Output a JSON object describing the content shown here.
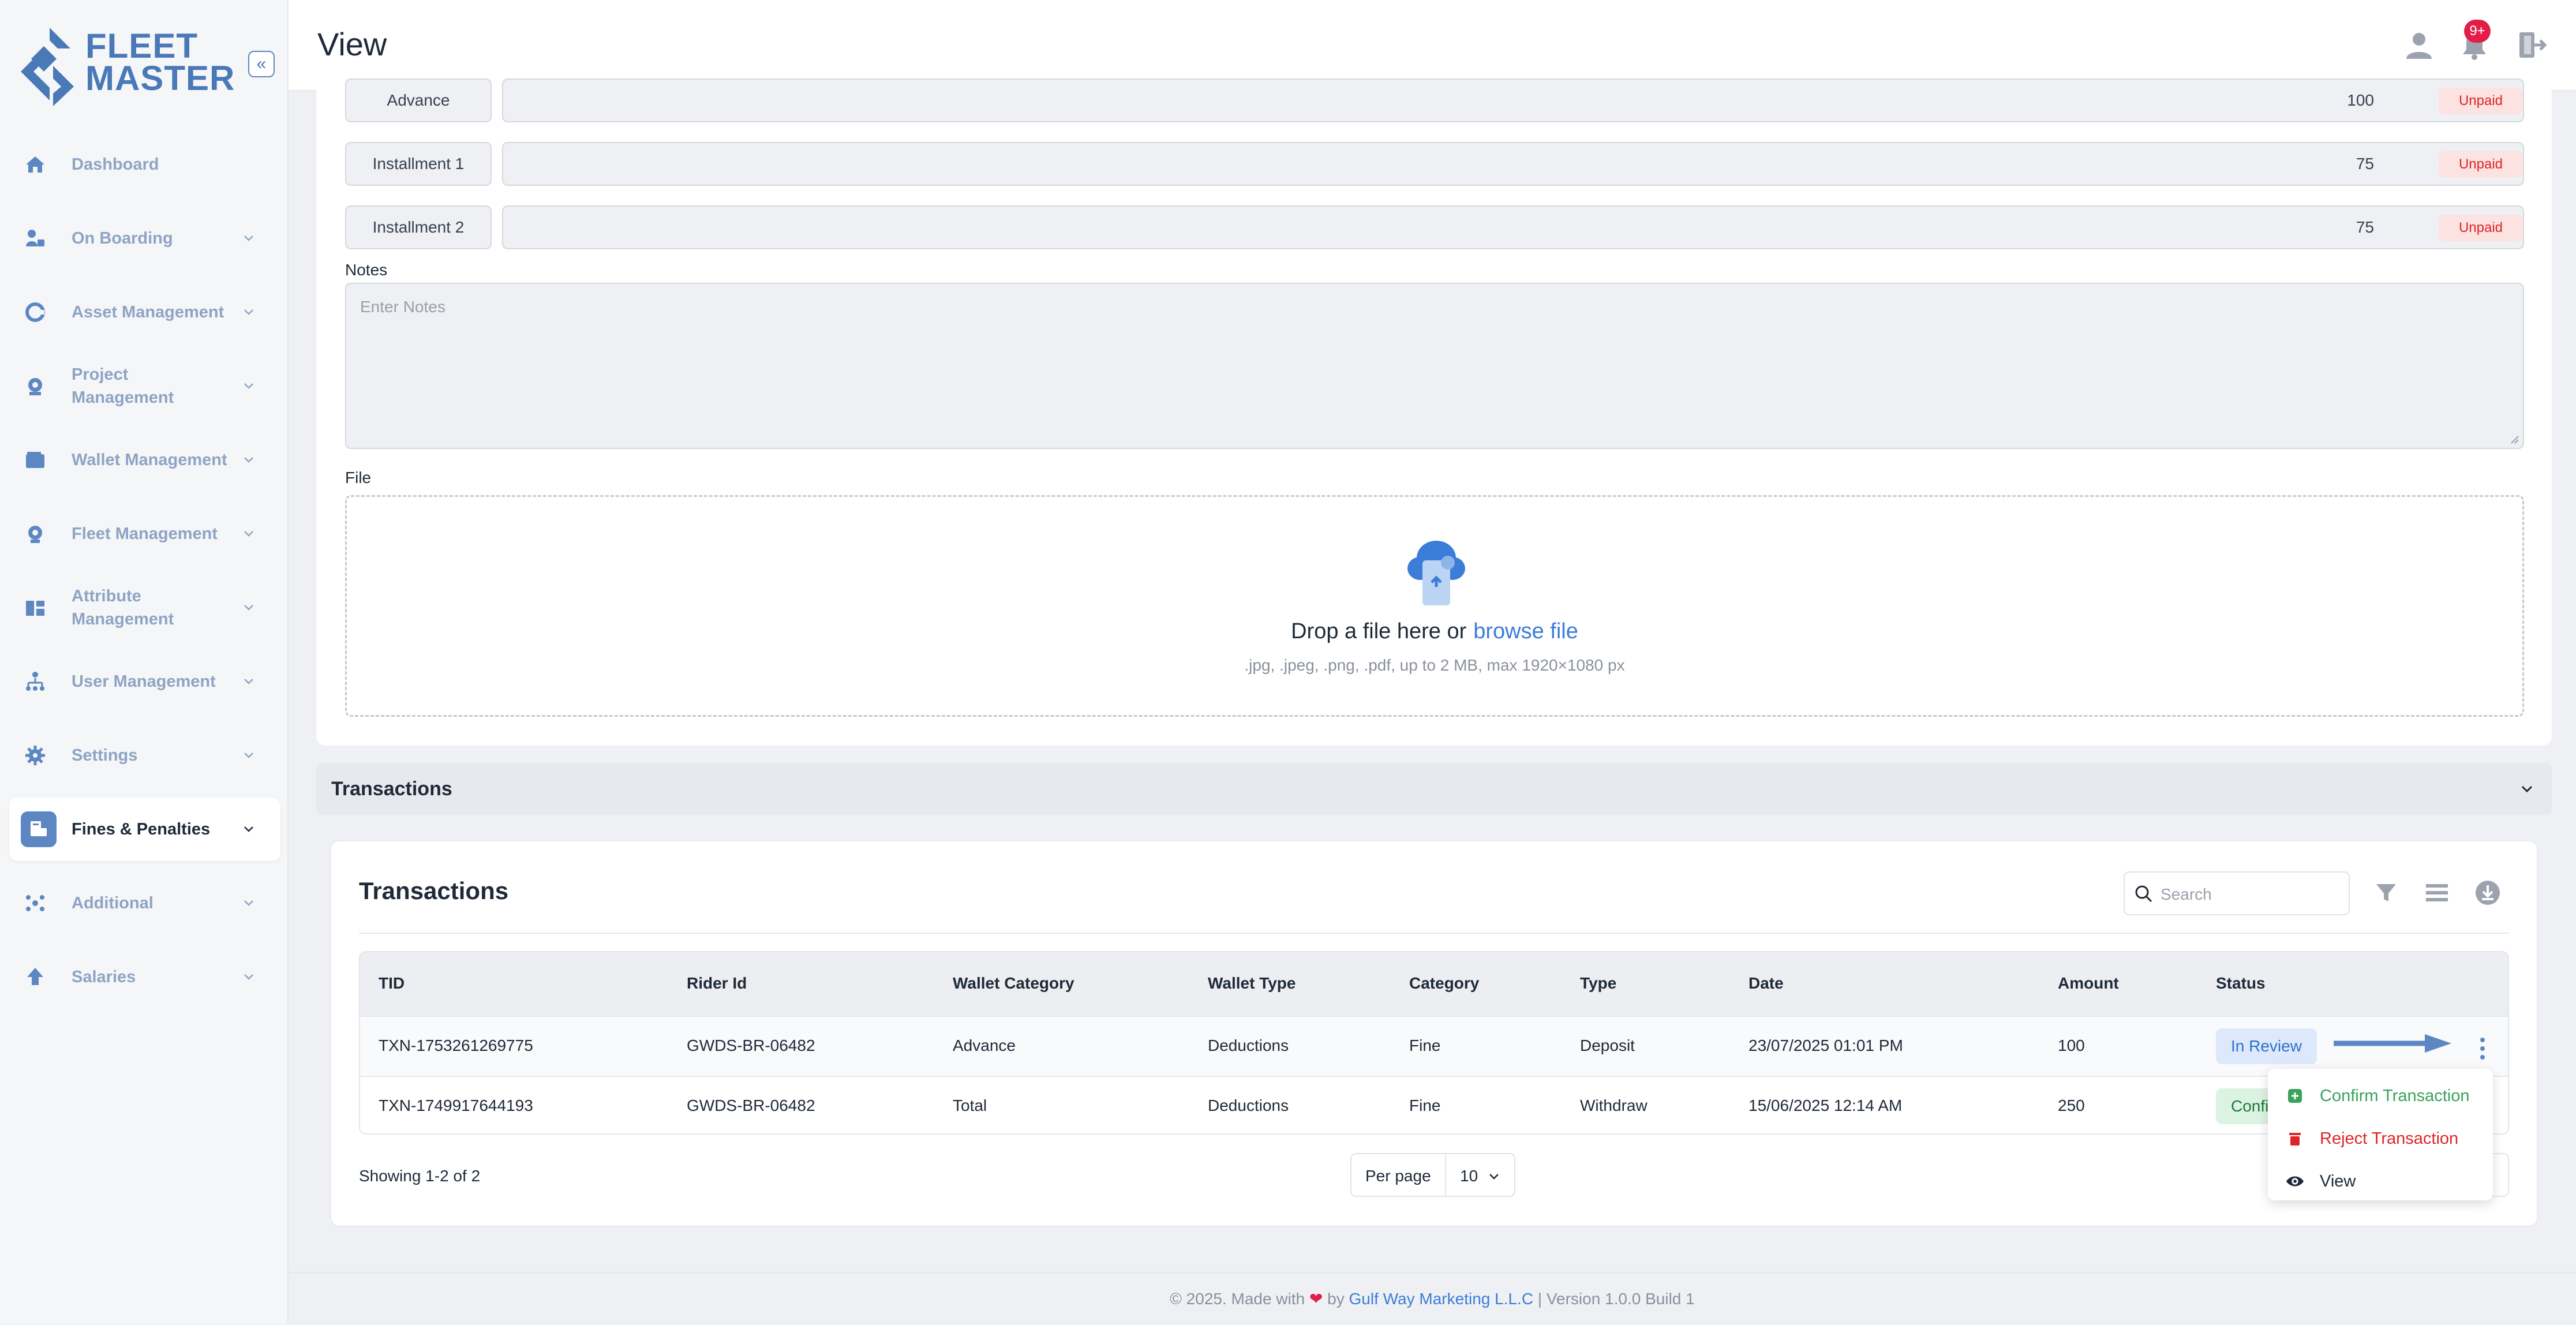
{
  "brand": {
    "line1": "FLEET",
    "line2": "MASTER",
    "color": "#4a79b8"
  },
  "header": {
    "title": "View",
    "notification_count": "9+"
  },
  "sidebar": {
    "items": [
      {
        "label": "Dashboard",
        "icon": "home-icon",
        "has_chevron": false,
        "active": false
      },
      {
        "label": "On Boarding",
        "icon": "onboarding-icon",
        "has_chevron": true,
        "active": false
      },
      {
        "label": "Asset Management",
        "icon": "asset-icon",
        "has_chevron": true,
        "active": false
      },
      {
        "label": "Project Management",
        "icon": "project-icon",
        "has_chevron": true,
        "active": false
      },
      {
        "label": "Wallet Management",
        "icon": "wallet-icon",
        "has_chevron": true,
        "active": false
      },
      {
        "label": "Fleet Management",
        "icon": "fleet-icon",
        "has_chevron": true,
        "active": false
      },
      {
        "label": "Attribute Management",
        "icon": "attribute-icon",
        "has_chevron": true,
        "active": false
      },
      {
        "label": "User Management",
        "icon": "users-icon",
        "has_chevron": true,
        "active": false
      },
      {
        "label": "Settings",
        "icon": "gear-icon",
        "has_chevron": true,
        "active": false
      },
      {
        "label": "Fines & Penalties",
        "icon": "fines-icon",
        "has_chevron": true,
        "active": true
      },
      {
        "label": "Additional",
        "icon": "additional-icon",
        "has_chevron": true,
        "active": false
      },
      {
        "label": "Salaries",
        "icon": "salaries-icon",
        "has_chevron": true,
        "active": false
      }
    ]
  },
  "installments": [
    {
      "label": "Advance",
      "amount": "100",
      "status": "Unpaid"
    },
    {
      "label": "Installment 1",
      "amount": "75",
      "status": "Unpaid"
    },
    {
      "label": "Installment 2",
      "amount": "75",
      "status": "Unpaid"
    }
  ],
  "notes": {
    "label": "Notes",
    "placeholder": "Enter Notes"
  },
  "file": {
    "label": "File",
    "drop_text": "Drop a file here or",
    "browse_text": "browse file",
    "hint": ".jpg, .jpeg, .png, .pdf, up to 2 MB, max 1920×1080 px"
  },
  "accordion": {
    "title": "Transactions"
  },
  "transactions": {
    "title": "Transactions",
    "search_placeholder": "Search",
    "columns": [
      "TID",
      "Rider Id",
      "Wallet Category",
      "Wallet Type",
      "Category",
      "Type",
      "Date",
      "Amount",
      "Status"
    ],
    "rows": [
      {
        "tid": "TXN-1753261269775",
        "rider_id": "GWDS-BR-06482",
        "wallet_category": "Advance",
        "wallet_type": "Deductions",
        "category": "Fine",
        "type": "Deposit",
        "date": "23/07/2025 01:01 PM",
        "amount": "100",
        "status": "In Review"
      },
      {
        "tid": "TXN-1749917644193",
        "rider_id": "GWDS-BR-06482",
        "wallet_category": "Total",
        "wallet_type": "Deductions",
        "category": "Fine",
        "type": "Withdraw",
        "date": "15/06/2025 12:14 AM",
        "amount": "250",
        "status": "Confi"
      }
    ],
    "showing": "Showing 1-2 of 2",
    "per_page_label": "Per page",
    "per_page_value": "10"
  },
  "action_menu": {
    "confirm": "Confirm Transaction",
    "reject": "Reject Transaction",
    "view": "View"
  },
  "footer": {
    "prefix": "© 2025. Made with",
    "by": "by",
    "company": "Gulf Way Marketing L.L.C",
    "suffix": "| Version 1.0.0 Build 1"
  },
  "colors": {
    "accent": "#5d87c2",
    "unpaid_bg": "#fde2e2",
    "unpaid_text": "#dc2626",
    "review_bg": "#dde9fb",
    "confirm_bg": "#dcf3e3",
    "link": "#3b7dd8"
  }
}
